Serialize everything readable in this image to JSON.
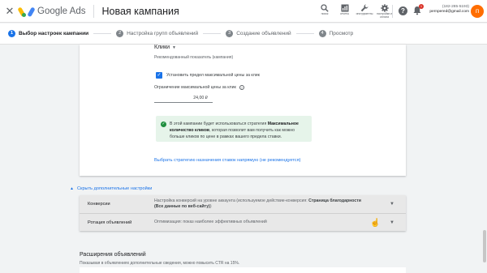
{
  "app": {
    "close_icon": "close-icon",
    "logo_text": "Google Ads",
    "campaign_title": "Новая кампания"
  },
  "toolbar": {
    "tools": [
      {
        "icon": "search-icon",
        "label": "поиск"
      },
      {
        "icon": "reports-icon",
        "label": "отчеты"
      },
      {
        "icon": "wrench-icon",
        "label": "инструменты"
      },
      {
        "icon": "settings-icon",
        "label": "настройки и оплата"
      }
    ],
    "notifications_count": "1",
    "account_id": "(182-285-5193)",
    "account_email": "pernpered@gmail.com",
    "avatar_letter": "п"
  },
  "stepper": {
    "steps": [
      {
        "num": "1",
        "label": "Выбор настроек кампании",
        "active": true
      },
      {
        "num": "2",
        "label": "Настройка групп объявлений",
        "active": false
      },
      {
        "num": "3",
        "label": "Создание объявлений",
        "active": false
      },
      {
        "num": "4",
        "label": "Просмотр",
        "active": false
      }
    ]
  },
  "bidding": {
    "selected": "Клики",
    "hint": "Рекомендованный показатель (кампания)",
    "max_cpc_checkbox_label": "Установить предел максимальной цены за клик",
    "max_cpc_checked": true,
    "limit_label": "Ограничение максимальной цены за клик",
    "limit_value": "24,00 ₽",
    "info_prefix": "В этой кампании будет использоваться стратегия ",
    "info_strategy": "Максимальное количество кликов",
    "info_suffix": ", которая позволит вам получить как можно больше кликов по цене в рамках вашего предела ставки.",
    "manual_link": "Выбрать стратегию назначения ставок напрямую (не рекомендуется)"
  },
  "more_settings": {
    "toggle_label": "Скрыть дополнительные настройки",
    "rows": [
      {
        "name": "Конверсии",
        "value_prefix": "Настройка конверсий на уровне аккаунта (используемое действие-конверсия: ",
        "value_bold": "Страница благодарности (Все данные по веб-сайту)",
        "value_suffix": ")"
      },
      {
        "name": "Ротация объявлений",
        "value_prefix": "Оптимизация: показ наиболее эффективных объявлений",
        "value_bold": "",
        "value_suffix": ""
      }
    ]
  },
  "extensions": {
    "title": "Расширения объявлений",
    "description": "Показывая в объявлениях дополнительные сведения, можно повысить CTR на 15%."
  },
  "colors": {
    "accent": "#1a73e8",
    "success_bg": "#e6f4ea",
    "success": "#1e8e3e",
    "avatar": "#ff6d00"
  }
}
